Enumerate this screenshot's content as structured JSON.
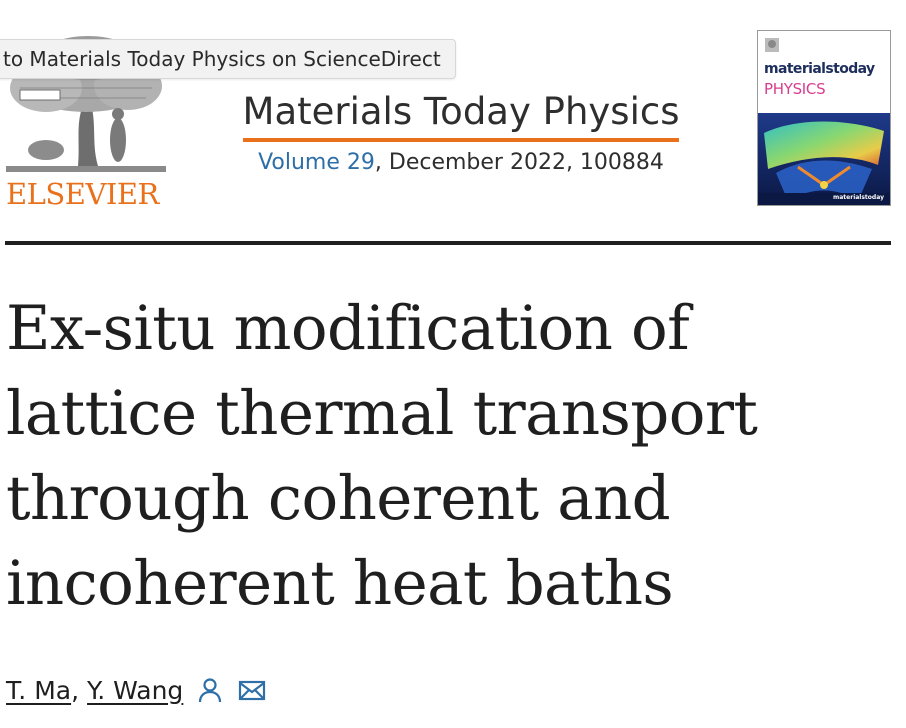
{
  "tooltip": {
    "text": "to Materials Today Physics on ScienceDirect"
  },
  "publisher": {
    "name": "ELSEVIER"
  },
  "journal": {
    "title": "Materials Today Physics",
    "volume_link": "Volume 29",
    "issue_rest": ", December 2022, 100884"
  },
  "cover": {
    "brand": "materialstoday",
    "subject": "PHYSICS",
    "footer": "materialstoday",
    "accent_color": "#d93d8e"
  },
  "article": {
    "title": "Ex-situ modification of lattice thermal transport through coherent and incoherent heat baths"
  },
  "authors": {
    "list": [
      {
        "name": "T. Ma",
        "separator": ","
      },
      {
        "name": "Y. Wang",
        "separator": ""
      }
    ],
    "icons": [
      "person-icon",
      "envelope-icon"
    ]
  },
  "colors": {
    "brand_orange": "#e9711c",
    "link_blue": "#2e6fa8",
    "text": "#1f1f1f"
  }
}
